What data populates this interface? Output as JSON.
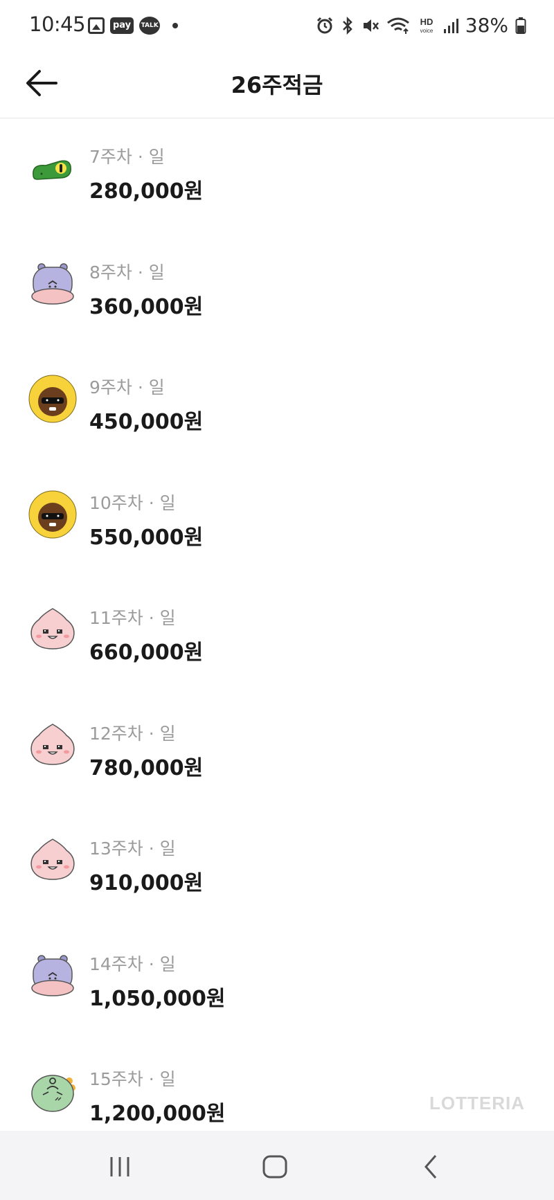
{
  "status_bar": {
    "time": "10:45",
    "pay_label": "pay",
    "talk_label": "TALK",
    "hd_label": "HD",
    "voice_label": "voice",
    "battery": "38%"
  },
  "header": {
    "title": "26주적금"
  },
  "items": [
    {
      "week": "7주차 · 일",
      "amount": "280,000원",
      "avatar": "lizard-character-icon"
    },
    {
      "week": "8주차 · 일",
      "amount": "360,000원",
      "avatar": "hippo-character-icon"
    },
    {
      "week": "9주차 · 일",
      "amount": "450,000원",
      "avatar": "afro-sunglasses-character-icon"
    },
    {
      "week": "10주차 · 일",
      "amount": "550,000원",
      "avatar": "afro-sunglasses-character-icon"
    },
    {
      "week": "11주차 · 일",
      "amount": "660,000원",
      "avatar": "peach-character-icon"
    },
    {
      "week": "12주차 · 일",
      "amount": "780,000원",
      "avatar": "peach-character-icon"
    },
    {
      "week": "13주차 · 일",
      "amount": "910,000원",
      "avatar": "peach-character-icon"
    },
    {
      "week": "14주차 · 일",
      "amount": "1,050,000원",
      "avatar": "hippo-character-icon"
    },
    {
      "week": "15주차 · 일",
      "amount": "1,200,000원",
      "avatar": "dino-character-icon"
    }
  ],
  "watermark": "LOTTERIA",
  "colors": {
    "accent_text": "#1a1a1a",
    "muted_text": "#9b9b9b",
    "nav_bg": "#f4f4f6"
  }
}
